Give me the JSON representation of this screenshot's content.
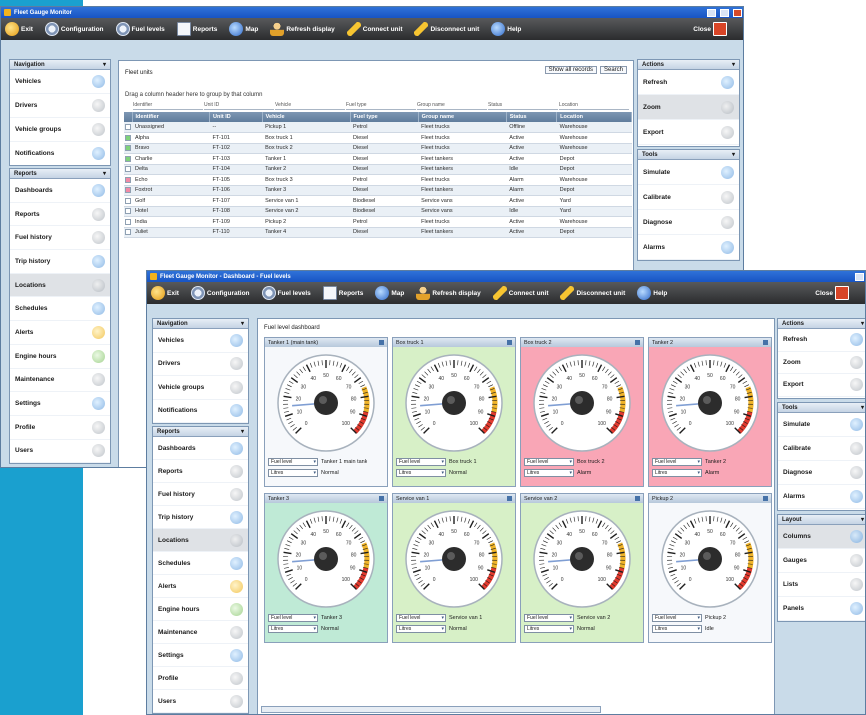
{
  "back_window": {
    "title": "Fleet Gauge Monitor",
    "toolbar": [
      {
        "label": "Exit",
        "icon": "exit-icon"
      },
      {
        "label": "Configuration",
        "icon": "gear-icon"
      },
      {
        "label": "Fuel levels",
        "icon": "gear-icon"
      },
      {
        "label": "Reports",
        "icon": "report-icon"
      },
      {
        "label": "Map",
        "icon": "globe-icon"
      },
      {
        "label": "Refresh display",
        "icon": "user-icon"
      },
      {
        "label": "Connect unit",
        "icon": "key-icon"
      },
      {
        "label": "Disconnect unit",
        "icon": "key-icon"
      },
      {
        "label": "Help",
        "icon": "help-icon"
      }
    ],
    "close_label": "Close",
    "left_panel1": {
      "title": "Navigation",
      "items": [
        "Vehicles",
        "Drivers",
        "Vehicle groups",
        "Notifications"
      ]
    },
    "left_panel2": {
      "title": "Reports",
      "items": [
        "Dashboards",
        "Reports",
        "Fuel history",
        "Trip history",
        "Locations",
        "Schedules",
        "Alerts",
        "Engine hours",
        "Maintenance",
        "Settings",
        "Profile",
        "Users"
      ]
    },
    "right_panel1": {
      "title": "Actions",
      "items": [
        "Refresh",
        "Zoom",
        "Export"
      ]
    },
    "right_panel2": {
      "title": "Tools",
      "items": [
        "Simulate",
        "Calibrate",
        "Diagnose",
        "Alarms"
      ]
    },
    "grid": {
      "title": "Fleet units",
      "hint": "Drag a column header here to group by that column",
      "filter_label": "Show all records",
      "filter_btn": "Search",
      "columns": [
        "",
        "Identifier",
        "Unit ID",
        "Vehicle",
        "Fuel type",
        "Group name",
        "Status",
        "Location"
      ],
      "rows": [
        {
          "c": [
            "",
            "Unassigned",
            "--",
            "Pickup 1",
            "Petrol",
            "Fleet trucks",
            "Offline",
            "Warehouse"
          ],
          "sw": "#ffffff"
        },
        {
          "c": [
            "",
            "Alpha",
            "FT-101",
            "Box truck 1",
            "Diesel",
            "Fleet trucks",
            "Active",
            "Warehouse"
          ],
          "sw": "#7fd27a"
        },
        {
          "c": [
            "",
            "Bravo",
            "FT-102",
            "Box truck 2",
            "Diesel",
            "Fleet trucks",
            "Active",
            "Warehouse"
          ],
          "sw": "#7fd27a"
        },
        {
          "c": [
            "",
            "Charlie",
            "FT-103",
            "Tanker 1",
            "Diesel",
            "Fleet tankers",
            "Active",
            "Depot"
          ],
          "sw": "#7fd27a"
        },
        {
          "c": [
            "",
            "Delta",
            "FT-104",
            "Tanker 2",
            "Diesel",
            "Fleet tankers",
            "Idle",
            "Depot"
          ],
          "sw": "#ffffff"
        },
        {
          "c": [
            "",
            "Echo",
            "FT-105",
            "Box truck 3",
            "Petrol",
            "Fleet trucks",
            "Alarm",
            "Warehouse"
          ],
          "sw": "#f28aa6"
        },
        {
          "c": [
            "",
            "Foxtrot",
            "FT-106",
            "Tanker 3",
            "Diesel",
            "Fleet tankers",
            "Alarm",
            "Depot"
          ],
          "sw": "#f28aa6"
        },
        {
          "c": [
            "",
            "Golf",
            "FT-107",
            "Service van 1",
            "Biodiesel",
            "Service vans",
            "Active",
            "Yard"
          ],
          "sw": "#ffffff"
        },
        {
          "c": [
            "",
            "Hotel",
            "FT-108",
            "Service van 2",
            "Biodiesel",
            "Service vans",
            "Idle",
            "Yard"
          ],
          "sw": "#ffffff"
        },
        {
          "c": [
            "",
            "India",
            "FT-109",
            "Pickup 2",
            "Petrol",
            "Fleet trucks",
            "Active",
            "Warehouse"
          ],
          "sw": "#ffffff"
        },
        {
          "c": [
            "",
            "Juliet",
            "FT-110",
            "Tanker 4",
            "Diesel",
            "Fleet tankers",
            "Active",
            "Depot"
          ],
          "sw": "#ffffff"
        }
      ]
    }
  },
  "front_window": {
    "title": "Fleet Gauge Monitor - Dashboard - Fuel levels",
    "toolbar": [
      {
        "label": "Exit",
        "icon": "exit-icon"
      },
      {
        "label": "Configuration",
        "icon": "gear-icon"
      },
      {
        "label": "Fuel levels",
        "icon": "gear-icon"
      },
      {
        "label": "Reports",
        "icon": "report-icon"
      },
      {
        "label": "Map",
        "icon": "globe-icon"
      },
      {
        "label": "Refresh display",
        "icon": "user-icon"
      },
      {
        "label": "Connect unit",
        "icon": "key-icon"
      },
      {
        "label": "Disconnect unit",
        "icon": "key-icon"
      },
      {
        "label": "Help",
        "icon": "help-icon"
      }
    ],
    "close_label": "Close",
    "left_panel1": {
      "title": "Navigation",
      "items": [
        "Vehicles",
        "Drivers",
        "Vehicle groups",
        "Notifications"
      ]
    },
    "left_panel2": {
      "title": "Reports",
      "items": [
        "Dashboards",
        "Reports",
        "Fuel history",
        "Trip history",
        "Locations",
        "Schedules",
        "Alerts",
        "Engine hours",
        "Maintenance",
        "Settings",
        "Profile",
        "Users"
      ]
    },
    "right_panel1": {
      "title": "Actions",
      "items": [
        "Refresh",
        "Zoom",
        "Export"
      ]
    },
    "right_panel2": {
      "title": "Tools",
      "items": [
        "Simulate",
        "Calibrate",
        "Diagnose",
        "Alarms"
      ]
    },
    "right_panel3": {
      "title": "Layout",
      "items": [
        "Columns",
        "Gauges",
        "Lists",
        "Panels"
      ]
    },
    "dash_title": "Fuel level dashboard",
    "gauges": [
      {
        "title": "Tanker 1 (main tank)",
        "bg": "white",
        "value": 15,
        "sel1": "Fuel level",
        "sel2": "Litres",
        "label1": "Tanker 1 main tank",
        "label2": "Normal"
      },
      {
        "title": "Box truck 1",
        "bg": "green",
        "value": 15,
        "sel1": "Fuel level",
        "sel2": "Litres",
        "label1": "Box truck 1",
        "label2": "Normal"
      },
      {
        "title": "Box truck 2",
        "bg": "pink",
        "value": 15,
        "sel1": "Fuel level",
        "sel2": "Litres",
        "label1": "Box truck 2",
        "label2": "Alarm"
      },
      {
        "title": "Tanker 2",
        "bg": "pink",
        "value": 15,
        "sel1": "Fuel level",
        "sel2": "Litres",
        "label1": "Tanker 2",
        "label2": "Alarm"
      },
      {
        "title": "Tanker 3",
        "bg": "teal",
        "value": 15,
        "sel1": "Fuel level",
        "sel2": "Litres",
        "label1": "Tanker 3",
        "label2": "Normal"
      },
      {
        "title": "Service van 1",
        "bg": "green",
        "value": 15,
        "sel1": "Fuel level",
        "sel2": "Litres",
        "label1": "Service van 1",
        "label2": "Normal"
      },
      {
        "title": "Service van 2",
        "bg": "green",
        "value": 15,
        "sel1": "Fuel level",
        "sel2": "Litres",
        "label1": "Service van 2",
        "label2": "Normal"
      },
      {
        "title": "Pickup 2",
        "bg": "white",
        "value": 15,
        "sel1": "Fuel level",
        "sel2": "Litres",
        "label1": "Pickup 2",
        "label2": "Idle"
      }
    ],
    "gauge_scale": {
      "min": 0,
      "max": 100,
      "ticks": [
        0,
        10,
        20,
        30,
        40,
        50,
        60,
        70,
        80,
        90,
        100
      ],
      "warn_from": 75,
      "alarm_from": 88
    }
  }
}
